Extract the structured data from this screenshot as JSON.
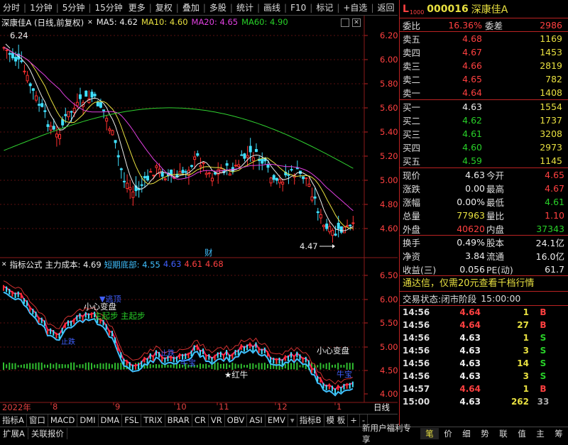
{
  "toolbar": {
    "items": [
      "分时",
      "1分钟",
      "5分钟",
      "15分钟",
      "更多",
      "复权",
      "叠加",
      "多股",
      "统计",
      "画线",
      "F10",
      "标记",
      "+自选",
      "返回"
    ]
  },
  "chart": {
    "title": "深康佳A (日线,前复权)",
    "ma5": "MA5: 4.62",
    "ma10": "MA10: 4.60",
    "ma20": "MA20: 4.65",
    "ma60": "MA60: 4.90",
    "high_label": "6.24",
    "low_label": "4.47",
    "cai_label": "财",
    "y_ticks": [
      "6.20",
      "6.00",
      "5.80",
      "5.60",
      "5.40",
      "5.20",
      "5.00",
      "4.80",
      "4.60"
    ]
  },
  "indicator": {
    "name": "指标公式",
    "main_cost": "主力成本: 4.69",
    "short_bottom": "短期底部: 4.55",
    "v1": "4.63",
    "v2": "4.61",
    "v3": "4.68",
    "y_ticks": [
      "6.50",
      "6.00",
      "5.50",
      "5.00",
      "4.50",
      "4.00"
    ],
    "labels": {
      "tl1": "▼逃顶",
      "tl2": "小心变盘",
      "tl3": "主起步",
      "tl4": "主起步",
      "tl5": "小心变盘",
      "tl6": "★红牛",
      "tl7": "牛宝",
      "tl8": "牛宝",
      "tl9": "止跌",
      "tl10": "止跌"
    }
  },
  "xaxis": {
    "labels": [
      "2022年",
      "8",
      "9",
      "10",
      "11",
      "12",
      "1"
    ],
    "period": "日线"
  },
  "tabs": [
    "指标A",
    "窗口",
    "MACD",
    "DMI",
    "DMA",
    "FSL",
    "TRIX",
    "BRAR",
    "CR",
    "VR",
    "OBV",
    "ASI",
    "EMV",
    "指标B",
    "模 板",
    "+",
    "-"
  ],
  "bottom": {
    "left": [
      "扩展A",
      "关联报价"
    ],
    "promo": "新用户福利专享",
    "right_tabs": [
      "笔",
      "价",
      "细",
      "势",
      "联",
      "值",
      "主",
      "筹"
    ]
  },
  "quote": {
    "marker": "L",
    "level": "1000",
    "code": "000016",
    "name": "深康佳A",
    "weibi_label": "委比",
    "weibi": "16.36%",
    "weicha_label": "委差",
    "weicha": "2986",
    "asks": [
      {
        "label": "卖五",
        "price": "4.68",
        "vol": "1169"
      },
      {
        "label": "卖四",
        "price": "4.67",
        "vol": "1453"
      },
      {
        "label": "卖三",
        "price": "4.66",
        "vol": "2819"
      },
      {
        "label": "卖二",
        "price": "4.65",
        "vol": "782"
      },
      {
        "label": "卖一",
        "price": "4.64",
        "vol": "1408"
      }
    ],
    "bids": [
      {
        "label": "买一",
        "price": "4.63",
        "vol": "1554"
      },
      {
        "label": "买二",
        "price": "4.62",
        "vol": "1737"
      },
      {
        "label": "买三",
        "price": "4.61",
        "vol": "3208"
      },
      {
        "label": "买四",
        "price": "4.60",
        "vol": "2973"
      },
      {
        "label": "买五",
        "price": "4.59",
        "vol": "1145"
      }
    ],
    "stats": [
      {
        "k": "现价",
        "v": "4.63",
        "k2": "今开",
        "v2": "4.65"
      },
      {
        "k": "涨跌",
        "v": "0.00",
        "k2": "最高",
        "v2": "4.67"
      },
      {
        "k": "涨幅",
        "v": "0.00%",
        "k2": "最低",
        "v2": "4.61"
      },
      {
        "k": "总量",
        "v": "77963",
        "k2": "量比",
        "v2": "1.10"
      },
      {
        "k": "外盘",
        "v": "40620",
        "k2": "内盘",
        "v2": "37343"
      },
      {
        "k": "换手",
        "v": "0.49%",
        "k2": "股本",
        "v2": "24.1亿"
      },
      {
        "k": "净资",
        "v": "3.84",
        "k2": "流通",
        "v2": "16.0亿"
      },
      {
        "k": "收益(三)",
        "v": "0.056",
        "k2": "PE(动)",
        "v2": "61.7"
      }
    ],
    "notice": "通达信，仅需20元查看千档行情",
    "trade_status_label": "交易状态:",
    "trade_status": "闭市阶段",
    "trade_time": "15:00:00",
    "trades": [
      {
        "t": "14:56",
        "p": "4.64",
        "v": "1",
        "f": "B",
        "c": "red"
      },
      {
        "t": "14:56",
        "p": "4.64",
        "v": "27",
        "f": "B",
        "c": "red"
      },
      {
        "t": "14:56",
        "p": "4.63",
        "v": "1",
        "f": "S",
        "c": "white"
      },
      {
        "t": "14:56",
        "p": "4.63",
        "v": "3",
        "f": "S",
        "c": "white"
      },
      {
        "t": "14:56",
        "p": "4.63",
        "v": "14",
        "f": "S",
        "c": "white"
      },
      {
        "t": "14:56",
        "p": "4.63",
        "v": "3",
        "f": "S",
        "c": "white"
      },
      {
        "t": "14:57",
        "p": "4.64",
        "v": "1",
        "f": "B",
        "c": "red"
      },
      {
        "t": "15:00",
        "p": "4.63",
        "v": "262",
        "f": "33",
        "c": "white"
      }
    ]
  }
}
